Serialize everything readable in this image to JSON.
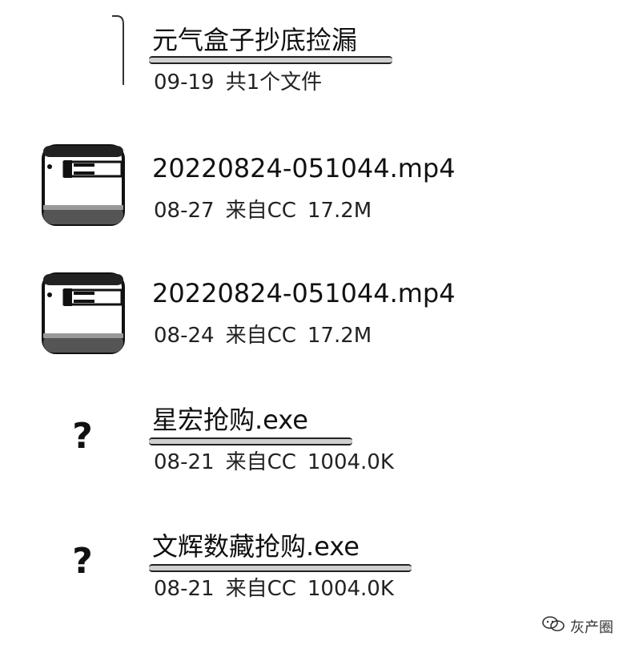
{
  "files": [
    {
      "name": "元气盒子抄底捡漏",
      "date": "09-19",
      "detail": "共1个文件",
      "size": "",
      "icon": "folder-icon"
    },
    {
      "name": "20220824-051044.mp4",
      "date": "08-27",
      "detail": "来自CC",
      "size": "17.2M",
      "icon": "video-thumbnail"
    },
    {
      "name": "20220824-051044.mp4",
      "date": "08-24",
      "detail": "来自CC",
      "size": "17.2M",
      "icon": "video-thumbnail"
    },
    {
      "name": "星宏抢购.exe",
      "date": "08-21",
      "detail": "来自CC",
      "size": "1004.0K",
      "icon": "unknown-file-icon",
      "glyph": "?"
    },
    {
      "name": "文辉数藏抢购.exe",
      "date": "08-21",
      "detail": "来自CC",
      "size": "1004.0K",
      "icon": "unknown-file-icon",
      "glyph": "?"
    }
  ],
  "watermark": {
    "text": "灰产圈",
    "icon": "wechat-icon"
  }
}
